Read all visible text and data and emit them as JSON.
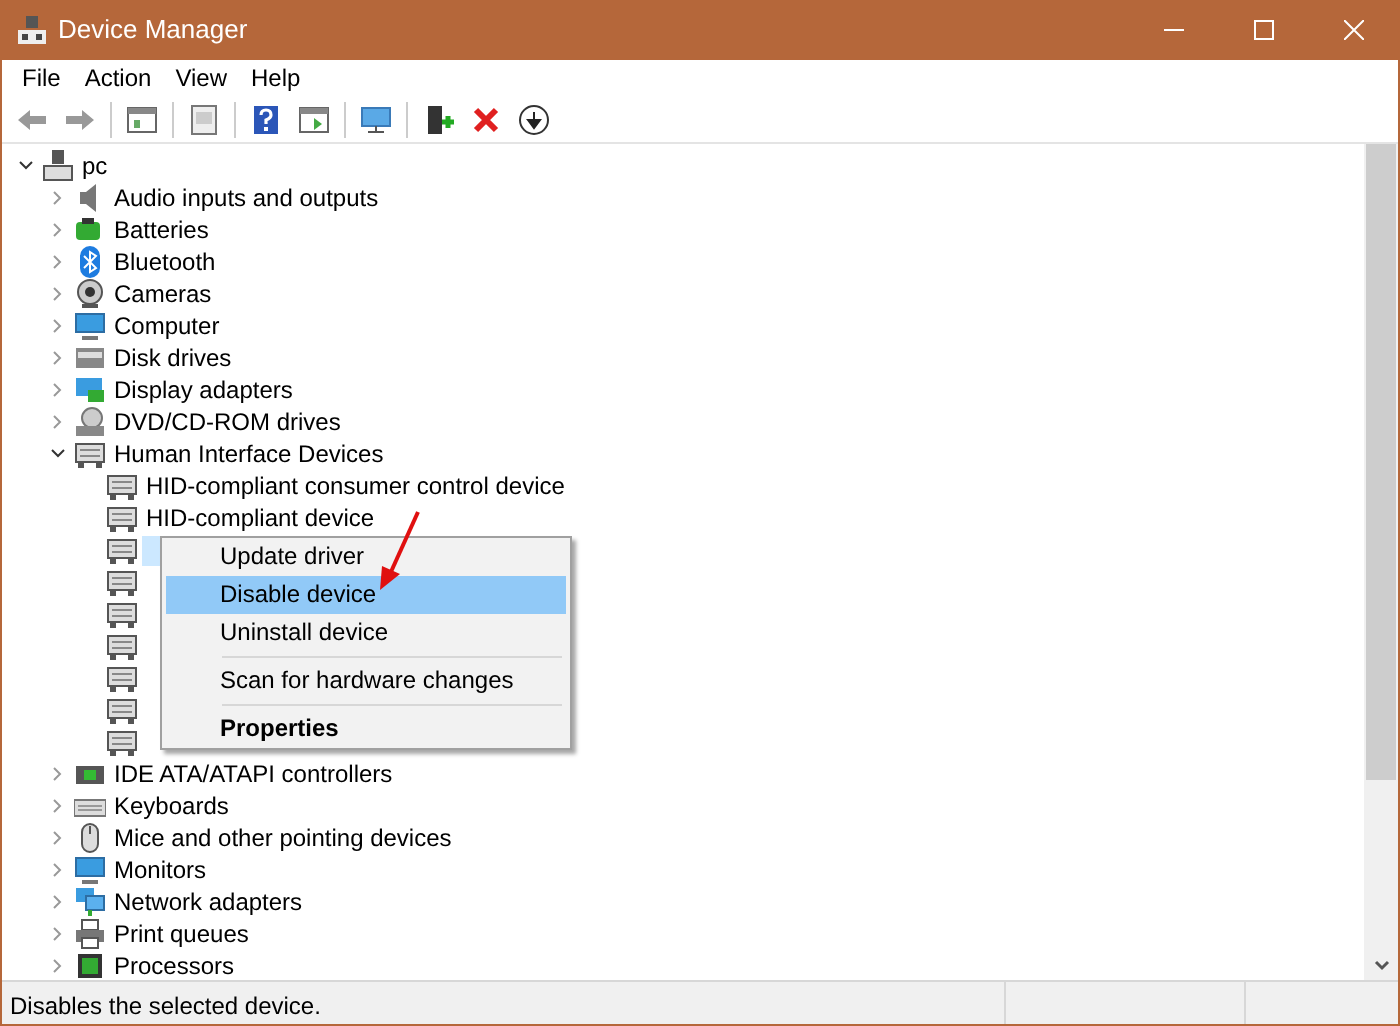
{
  "window": {
    "title": "Device Manager"
  },
  "menu": [
    "File",
    "Action",
    "View",
    "Help"
  ],
  "tree": {
    "label": "pc",
    "expanded": true,
    "children": [
      {
        "label": "Audio inputs and outputs",
        "expanded": false
      },
      {
        "label": "Batteries",
        "expanded": false
      },
      {
        "label": "Bluetooth",
        "expanded": false
      },
      {
        "label": "Cameras",
        "expanded": false
      },
      {
        "label": "Computer",
        "expanded": false
      },
      {
        "label": "Disk drives",
        "expanded": false
      },
      {
        "label": "Display adapters",
        "expanded": false
      },
      {
        "label": "DVD/CD-ROM drives",
        "expanded": false
      },
      {
        "label": "Human Interface Devices",
        "expanded": true,
        "children": [
          {
            "label": "HID-compliant consumer control device",
            "selected": false
          },
          {
            "label": "HID-compliant device",
            "selected": false
          },
          {
            "selected": true
          },
          {
            "selected": false
          },
          {
            "selected": false
          },
          {
            "selected": false
          },
          {
            "selected": false
          },
          {
            "selected": false
          },
          {
            "selected": false
          }
        ]
      },
      {
        "label": "IDE ATA/ATAPI controllers",
        "expanded": false
      },
      {
        "label": "Keyboards",
        "expanded": false
      },
      {
        "label": "Mice and other pointing devices",
        "expanded": false
      },
      {
        "label": "Monitors",
        "expanded": false
      },
      {
        "label": "Network adapters",
        "expanded": false
      },
      {
        "label": "Print queues",
        "expanded": false
      },
      {
        "label": "Processors",
        "expanded": false
      }
    ]
  },
  "context_menu": [
    {
      "kind": "item",
      "label": "Update driver",
      "selected": false,
      "default": false
    },
    {
      "kind": "item",
      "label": "Disable device",
      "selected": true,
      "default": false
    },
    {
      "kind": "item",
      "label": "Uninstall device",
      "selected": false,
      "default": false
    },
    {
      "kind": "separator"
    },
    {
      "kind": "item",
      "label": "Scan for hardware changes",
      "selected": false,
      "default": false
    },
    {
      "kind": "separator"
    },
    {
      "kind": "item",
      "label": "Properties",
      "selected": false,
      "default": true
    }
  ],
  "status_bar": {
    "text": "Disables the selected device."
  }
}
